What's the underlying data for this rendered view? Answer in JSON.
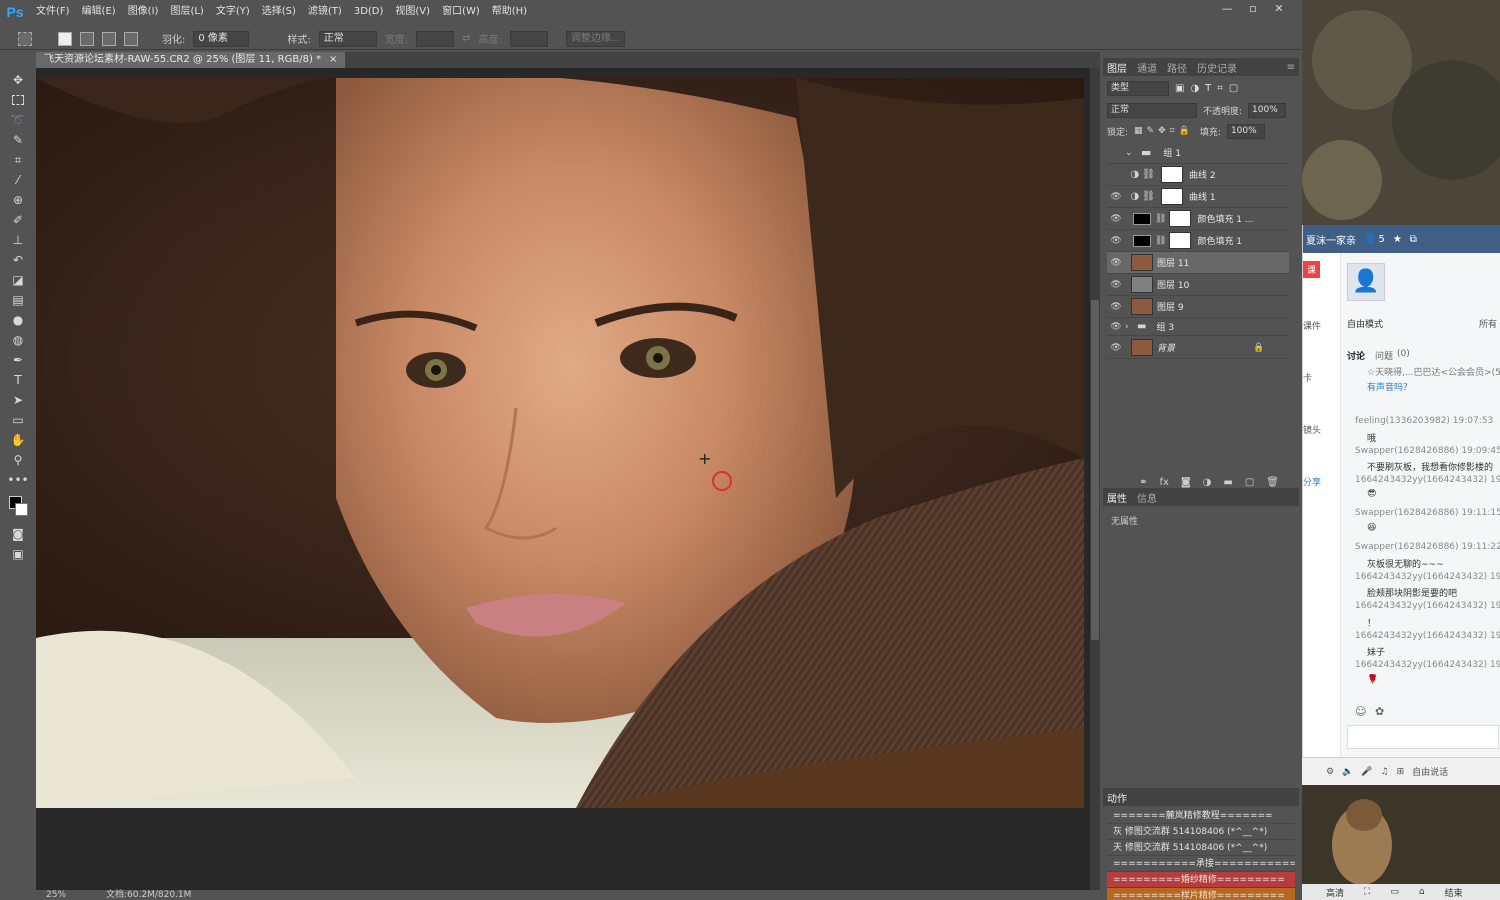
{
  "app": {
    "logo": "Ps",
    "menus": [
      "文件(F)",
      "编辑(E)",
      "图像(I)",
      "图层(L)",
      "文字(Y)",
      "选择(S)",
      "滤镜(T)",
      "3D(D)",
      "视图(V)",
      "窗口(W)",
      "帮助(H)"
    ],
    "window_buttons": [
      "—",
      "▫",
      "✕"
    ]
  },
  "options_bar": {
    "feather_label": "羽化:",
    "feather_value": "0 像素",
    "style_label": "样式:",
    "style_value": "正常",
    "width_label": "宽度:",
    "height_label": "高度:",
    "refine_edge": "调整边缘..."
  },
  "document": {
    "tab_title": "飞天资源论坛素材-RAW-55.CR2 @ 25% (图层 11, RGB/8) *",
    "close": "×",
    "zoom": "25%",
    "doc_size": "文档:60.2M/820.1M"
  },
  "layers_panel": {
    "tabs": [
      "图层",
      "通道",
      "路径",
      "历史记录"
    ],
    "kind_filter": "类型",
    "blend_mode": "正常",
    "opacity_label": "不透明度:",
    "opacity_value": "100%",
    "lock_label": "锁定:",
    "fill_label": "填充:",
    "fill_value": "100%",
    "layers": [
      {
        "name": "组 1",
        "kind": "group"
      },
      {
        "name": "曲线 2",
        "kind": "adjust"
      },
      {
        "name": "曲线 1",
        "kind": "adjust"
      },
      {
        "name": "颜色填充 1 ...",
        "kind": "fill"
      },
      {
        "name": "颜色填充 1",
        "kind": "fill"
      },
      {
        "name": "图层 11",
        "kind": "photo"
      },
      {
        "name": "图层 10",
        "kind": "gray"
      },
      {
        "name": "图层 9",
        "kind": "photo"
      },
      {
        "name": "组 3",
        "kind": "group"
      },
      {
        "name": "背景",
        "kind": "photo"
      }
    ]
  },
  "properties_panel": {
    "tabs": [
      "属性",
      "信息"
    ],
    "empty": "无属性"
  },
  "actions_panel": {
    "title": "动作",
    "items": [
      "=======麓岚精修教程=======",
      "灰 修图交流群 514108406 (*^__^*)",
      "天 修图交流群 514108406 (*^__^*)",
      "===========承接===========",
      "=========婚纱精修=========",
      "=========样片精修========="
    ]
  },
  "chat": {
    "header_name": "夏沫一家亲",
    "header_count": "5",
    "side_labels": [
      "课",
      "课件",
      "卡",
      "镜头",
      "分享"
    ],
    "mode": "自由模式",
    "all_label": "所有",
    "discuss_tab": "讨论",
    "question_tab": "问题",
    "question_count": "(0)",
    "notice": "☆天晓得,...巴巴达<公会会员>(57",
    "notice2": "有声音吗？",
    "messages": [
      {
        "meta": "feeling(1336203982) 19:07:53",
        "text": "哦"
      },
      {
        "meta": "Swapper(1628426886) 19:09:45",
        "text": "不要刷灰板，我想看你修影楼的"
      },
      {
        "meta": "1664243432yy(1664243432) 19:1",
        "text": "😎"
      },
      {
        "meta": "Swapper(1628426886) 19:11:15",
        "text": "😆"
      },
      {
        "meta": "Swapper(1628426886) 19:11:22",
        "text": "灰板很无聊的~~~"
      },
      {
        "meta": "1664243432yy(1664243432) 19:1",
        "text": "脸颊那块阴影是要的吧"
      },
      {
        "meta": "1664243432yy(1664243432) 19:1",
        "text": "！"
      },
      {
        "meta": "1664243432yy(1664243432) 19:2",
        "text": "妹子"
      },
      {
        "meta": "1664243432yy(1664243432) 19:2",
        "text": "🌹"
      }
    ],
    "bottom_say": "自由说话"
  },
  "video": {
    "quality": "高清",
    "end": "结束"
  }
}
